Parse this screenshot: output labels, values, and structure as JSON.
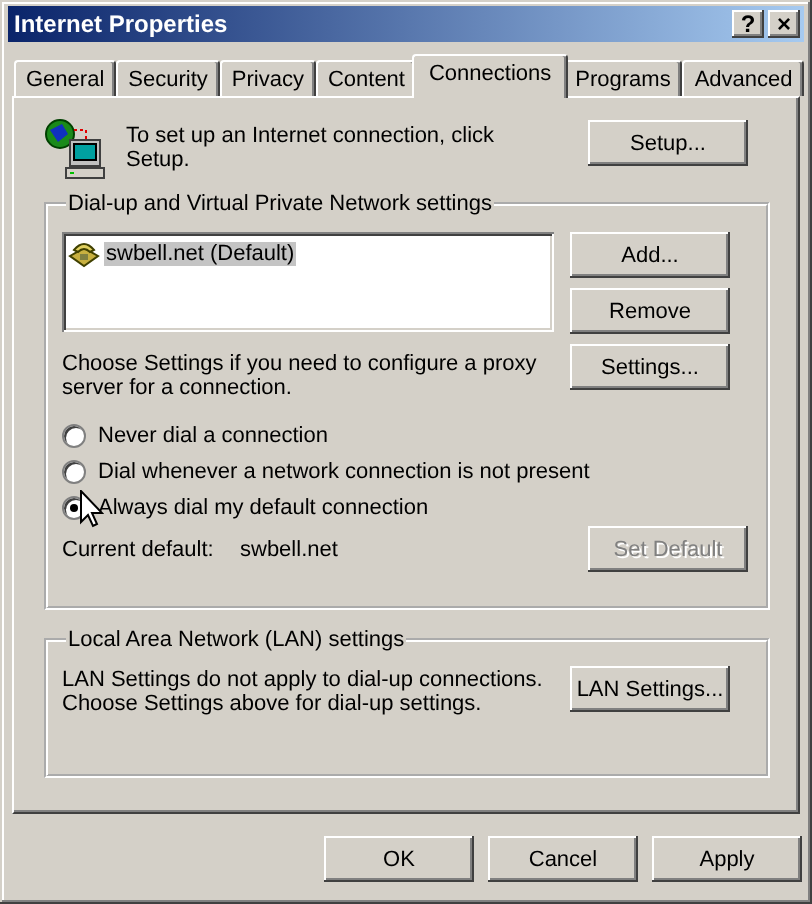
{
  "window": {
    "title": "Internet Properties",
    "controls": [
      "?",
      "×"
    ]
  },
  "tabs": [
    {
      "label": "General",
      "selected": false
    },
    {
      "label": "Security",
      "selected": false
    },
    {
      "label": "Privacy",
      "selected": false
    },
    {
      "label": "Content",
      "selected": false
    },
    {
      "label": "Connections",
      "selected": true
    },
    {
      "label": "Programs",
      "selected": false
    },
    {
      "label": "Advanced",
      "selected": false
    }
  ],
  "setup": {
    "text": "To set up an Internet connection, click Setup.",
    "button": "Setup..."
  },
  "dialup": {
    "title": "Dial-up and Virtual Private Network settings",
    "connections": [
      {
        "name": "swbell.net (Default)",
        "selected": true
      }
    ],
    "buttons": [
      "Add...",
      "Remove"
    ],
    "proxy_text": "Choose Settings if you need to configure a proxy server for a connection.",
    "settings_button": "Settings...",
    "options": [
      {
        "label": "Never dial a connection",
        "selected": false
      },
      {
        "label": "Dial whenever a network connection is not present",
        "selected": false
      },
      {
        "label": "Always dial my default connection",
        "selected": true
      }
    ],
    "current_default_label": "Current default:",
    "current_default": "swbell.net",
    "set_default": {
      "label": "Set Default",
      "disabled": true
    }
  },
  "lan": {
    "title": "Local Area Network (LAN) settings",
    "text": "LAN Settings do not apply to dial-up connections. Choose Settings above for dial-up settings.",
    "button": "LAN Settings..."
  },
  "buttons": [
    "OK",
    "Cancel",
    "Apply"
  ]
}
